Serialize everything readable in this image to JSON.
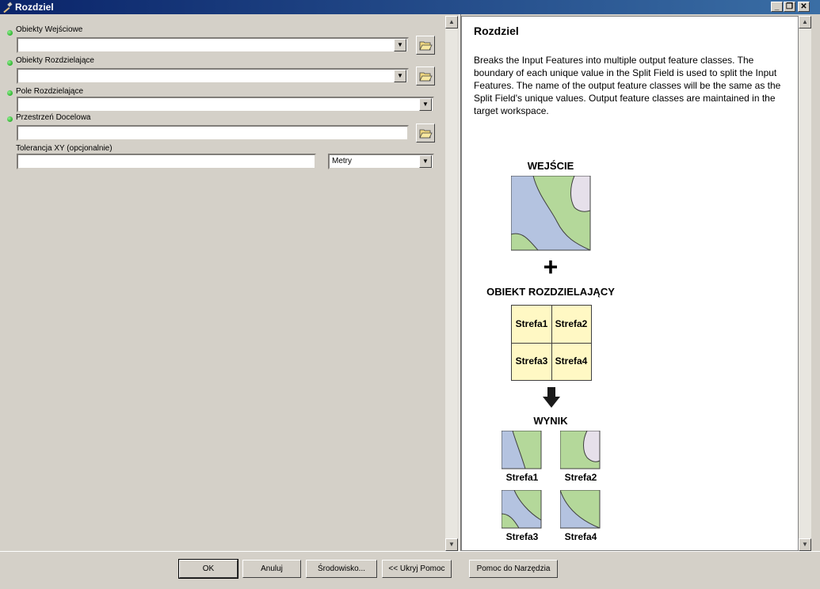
{
  "window": {
    "title": "Rozdziel",
    "buttons": [
      "_",
      "❐",
      "✕"
    ]
  },
  "form": {
    "fields": [
      {
        "label": "Obiekty Wejściowe",
        "required": true,
        "value": "",
        "has_dropdown": true,
        "has_browse": true
      },
      {
        "label": "Obiekty Rozdzielające",
        "required": true,
        "value": "",
        "has_dropdown": true,
        "has_browse": true
      },
      {
        "label": "Pole Rozdzielające",
        "required": true,
        "value": "",
        "has_dropdown": true,
        "has_browse": false
      },
      {
        "label": "Przestrzeń Docelowa",
        "required": true,
        "value": "",
        "has_dropdown": false,
        "has_browse": true
      }
    ],
    "tolerance": {
      "label": "Tolerancja XY (opcjonalnie)",
      "value": "",
      "unit": "Metry"
    }
  },
  "help": {
    "title": "Rozdziel",
    "text": "Breaks the Input Features into multiple output feature classes. The boundary of each unique value in the Split Field is used to split the Input Features. The name of the output feature classes will be the same as the Split Field's unique values. Output feature classes are maintained in the target workspace.",
    "diagram": {
      "input_label": "WEJŚCIE",
      "plus": "+",
      "split_label": "OBIEKT ROZDZIELAJĄCY",
      "zones": [
        "Strefa1",
        "Strefa2",
        "Strefa3",
        "Strefa4"
      ],
      "output_label": "WYNIK",
      "outputs": [
        "Strefa1",
        "Strefa2",
        "Strefa3",
        "Strefa4"
      ],
      "colors": {
        "blue": "#b4c3e0",
        "green": "#b4d89a",
        "lavender": "#e6e0ea",
        "yellow": "#fff8c4"
      }
    }
  },
  "buttons": {
    "ok": "OK",
    "cancel": "Anuluj",
    "env": "Środowisko...",
    "hide_help": "<< Ukryj Pomoc",
    "tool_help": "Pomoc do Narzędzia"
  }
}
